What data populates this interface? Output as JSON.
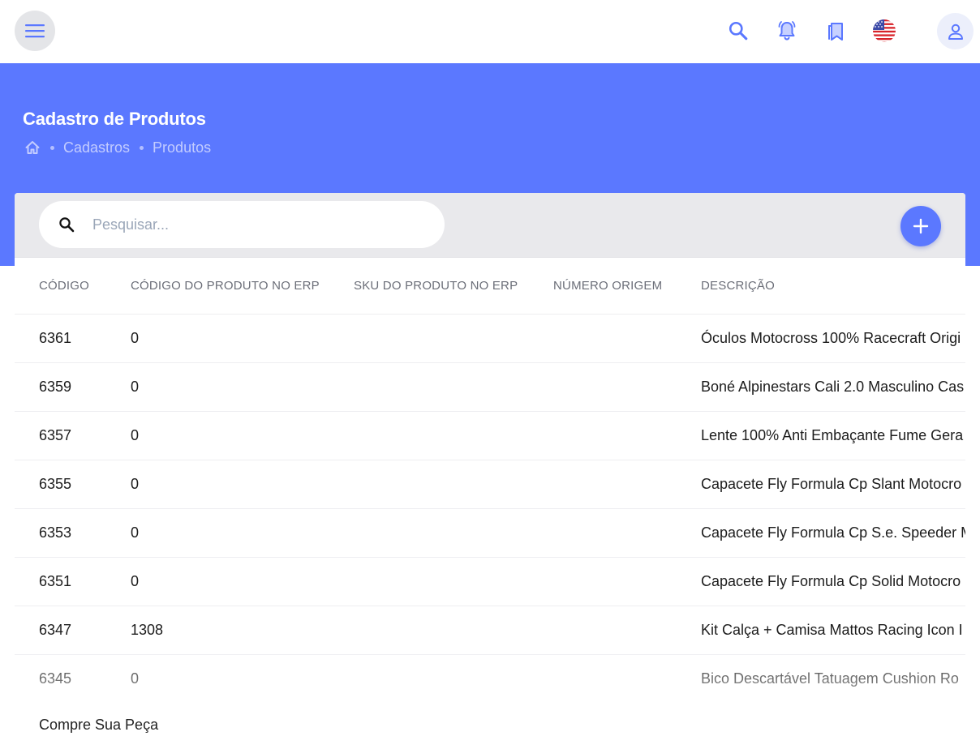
{
  "topbar": {
    "menu_icon": "hamburger-menu-icon",
    "icons": [
      "search-icon",
      "bell-alert-icon",
      "bookmarks-icon",
      "us-flag-icon",
      "user-icon"
    ],
    "accent": "#5b78ff"
  },
  "header": {
    "title": "Cadastro de Produtos",
    "breadcrumb": [
      "Cadastros",
      "Produtos"
    ],
    "background": "#5b78ff"
  },
  "search": {
    "placeholder": "Pesquisar...",
    "value": ""
  },
  "table": {
    "columns": [
      "CÓDIGO",
      "CÓDIGO DO PRODUTO NO ERP",
      "SKU DO PRODUTO NO ERP",
      "NÚMERO ORIGEM",
      "DESCRIÇÃO"
    ],
    "rows": [
      {
        "codigo": "6361",
        "erp": "0",
        "sku": "",
        "origem": "",
        "descricao": "Óculos Motocross 100% Racecraft Origi"
      },
      {
        "codigo": "6359",
        "erp": "0",
        "sku": "",
        "origem": "",
        "descricao": "Boné Alpinestars Cali 2.0 Masculino Cas"
      },
      {
        "codigo": "6357",
        "erp": "0",
        "sku": "",
        "origem": "",
        "descricao": "Lente 100% Anti Embaçante Fume Gera"
      },
      {
        "codigo": "6355",
        "erp": "0",
        "sku": "",
        "origem": "",
        "descricao": "Capacete Fly Formula Cp Slant Motocro"
      },
      {
        "codigo": "6353",
        "erp": "0",
        "sku": "",
        "origem": "",
        "descricao": "Capacete Fly Formula Cp S.e. Speeder M"
      },
      {
        "codigo": "6351",
        "erp": "0",
        "sku": "",
        "origem": "",
        "descricao": "Capacete Fly Formula Cp Solid Motocro"
      },
      {
        "codigo": "6347",
        "erp": "1308",
        "sku": "",
        "origem": "",
        "descricao": "Kit Calça + Camisa Mattos Racing Icon I"
      },
      {
        "codigo": "6345",
        "erp": "0",
        "sku": "",
        "origem": "",
        "descricao": "Bico Descartável Tatuagem Cushion Ro"
      }
    ]
  },
  "footer": {
    "text": "Compre Sua Peça"
  }
}
